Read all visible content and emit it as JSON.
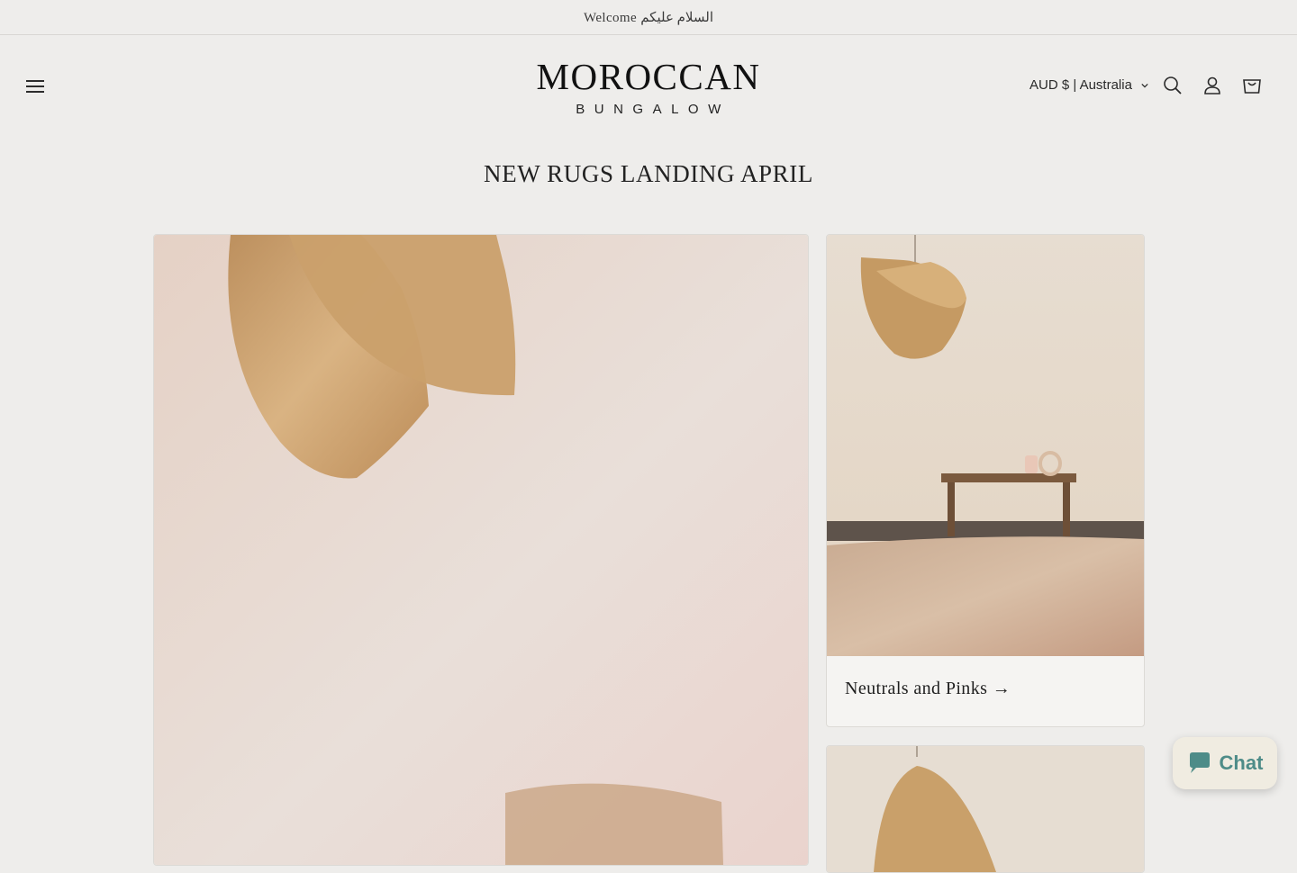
{
  "announcement": {
    "text": "Welcome السلام عليكم"
  },
  "header": {
    "logo_main": "MOROCCAN",
    "logo_sub": "BUNGALOW",
    "localization": "AUD $ | Australia"
  },
  "icons": {
    "menu": "hamburger-menu-icon",
    "search": "search-icon",
    "account": "account-icon",
    "cart": "cart-icon",
    "chat": "chat-bubble-icon"
  },
  "main": {
    "title": "NEW RUGS LANDING APRIL",
    "collections": [
      {
        "label": "Neutrals and Pinks →"
      }
    ]
  },
  "chat": {
    "label": "Chat"
  },
  "colors": {
    "background": "#eeedeb",
    "chat_text": "#4e8c88",
    "chat_bg": "#f0ece1"
  }
}
